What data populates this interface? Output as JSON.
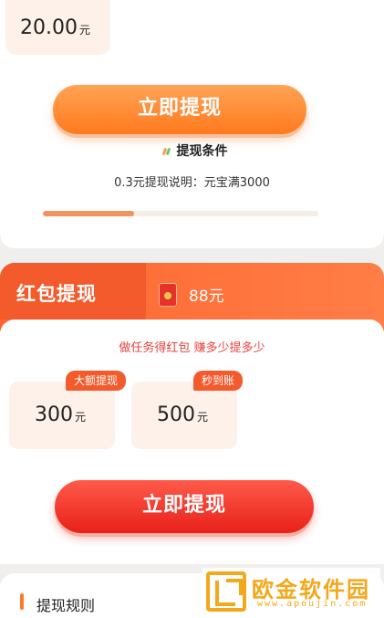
{
  "top_card": {
    "amount_value": "20.00",
    "amount_unit": "元",
    "withdraw_button": "立即提现",
    "condition_title": "提现条件",
    "condition_desc": "0.3元提现说明：元宝满3000",
    "progress_fraction": 0.33
  },
  "red_packet": {
    "title": "红包提现",
    "balance": "88元",
    "slogan": "做任务得红包 赚多少提多少",
    "options": [
      {
        "tag": "大额提现",
        "value": "300",
        "unit": "元"
      },
      {
        "tag": "秒到账",
        "value": "500",
        "unit": "元"
      }
    ],
    "withdraw_button": "立即提现"
  },
  "rules": {
    "title": "提现规则"
  },
  "watermark": {
    "name": "欧金软件园",
    "url": "www.apoujin.com"
  },
  "colors": {
    "orange_button": "#ff7a1d",
    "red_button": "#e8201a",
    "red_header": "#f35a2c",
    "watermark": "#f3a81b"
  }
}
